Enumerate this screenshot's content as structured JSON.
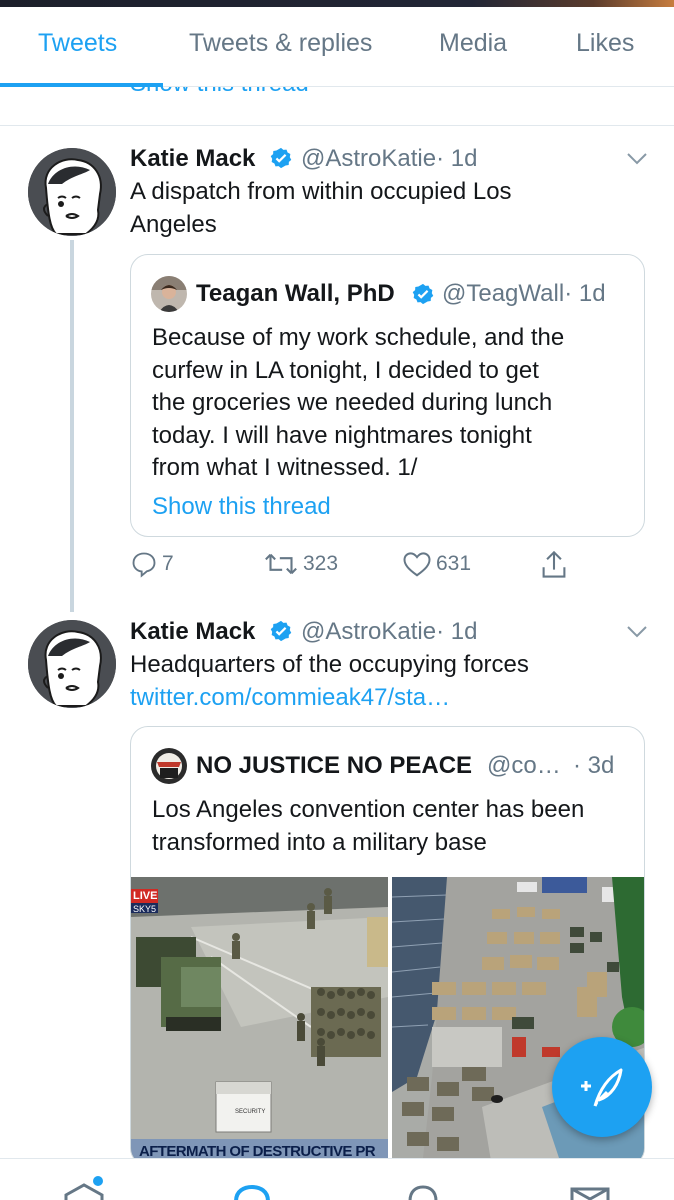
{
  "tabs": [
    {
      "label": "Tweets",
      "active": true
    },
    {
      "label": "Tweets & replies",
      "active": false
    },
    {
      "label": "Media",
      "active": false
    },
    {
      "label": "Likes",
      "active": false
    }
  ],
  "previous_tweet": {
    "show_thread": "Show this thread"
  },
  "tweets": [
    {
      "author": "Katie Mack",
      "handle": "@AstroKatie",
      "time": "· 1d",
      "text_lines": [
        "A dispatch from within occupied Los",
        "Angeles"
      ],
      "quote": {
        "author": "Teagan Wall, PhD",
        "handle": "@TeagWall",
        "time": "· 1d",
        "text_lines": [
          "Because of my work schedule, and the",
          "curfew in LA tonight, I decided to get",
          "the groceries we needed during lunch",
          "today. I will have nightmares tonight",
          "from what I witnessed. 1/"
        ],
        "show_thread": "Show this thread"
      },
      "actions": {
        "replies": "7",
        "retweets": "323",
        "likes": "631"
      }
    },
    {
      "author": "Katie Mack",
      "handle": "@AstroKatie",
      "time": "· 1d",
      "text": "Headquarters of the occupying forces",
      "link": "twitter.com/commieak47/sta…",
      "quote": {
        "author": "NO JUSTICE NO PEACE",
        "handle": "@co…",
        "time": "· 3d",
        "text_lines": [
          "Los Angeles convention center has been",
          "transformed into a military base"
        ],
        "image_overlay": {
          "live": "LIVE",
          "station": "SKY5",
          "security": "SECURITY",
          "banner": "AFTERMATH OF DESTRUCTIVE PR"
        }
      }
    }
  ],
  "colors": {
    "accent": "#1da1f2",
    "text": "#14171a",
    "secondary": "#657786",
    "border": "#e1e8ed"
  },
  "icons": {
    "verified": "verified-badge-icon",
    "caret": "chevron-down-icon",
    "reply": "reply-icon",
    "retweet": "retweet-icon",
    "like": "heart-icon",
    "share": "share-icon",
    "compose": "compose-tweet-icon",
    "home": "home-icon",
    "search": "search-icon",
    "notifications": "notifications-icon",
    "messages": "messages-icon"
  }
}
